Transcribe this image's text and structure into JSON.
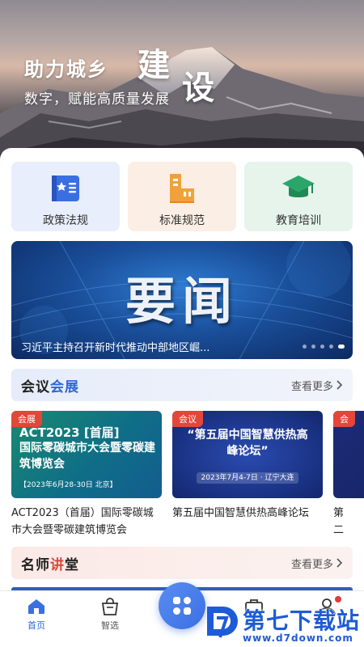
{
  "hero": {
    "title": "助力城乡",
    "big1": "建",
    "big2": "设",
    "subtitle": "数字，赋能高质量发展"
  },
  "categories": [
    {
      "label": "政策法规",
      "icon": "policy-book-icon",
      "color": "#3a6fe3"
    },
    {
      "label": "标准规范",
      "icon": "ruler-icon",
      "color": "#f0a23a"
    },
    {
      "label": "教育培训",
      "icon": "graduation-cap-icon",
      "color": "#2aa66a"
    }
  ],
  "banner": {
    "title": "要闻",
    "caption": "习近平主持召开新时代推动中部地区崛..."
  },
  "section_meetings": {
    "title_a": "会议",
    "title_b": "会展",
    "more": "查看更多"
  },
  "events": [
    {
      "tag": "会展",
      "thumb_line1": "ACT2023 [首届]",
      "thumb_line2": "国际零碳城市大会暨零碳建筑博览会",
      "thumb_line3": "【2023年6月28-30日 北京】",
      "caption": "ACT2023（首届）国际零碳城市大会暨零碳建筑博览会"
    },
    {
      "tag": "会议",
      "thumb_line1": "“第五届中国智慧供热高峰论坛”",
      "thumb_line3": "2023年7月4-7日 · 辽宁大连",
      "caption": "第五届中国智慧供热高峰论坛"
    },
    {
      "tag": "会",
      "caption": "第二筑发"
    }
  ],
  "section_teachers": {
    "title_a": "名师",
    "title_b": "讲",
    "title_c": "堂",
    "more": "查看更多"
  },
  "tabs": [
    {
      "label": "首页",
      "icon": "home-icon",
      "active": true
    },
    {
      "label": "智选",
      "icon": "shopping-bag-icon",
      "active": false
    },
    {
      "label": "",
      "icon": "apps-grid-icon",
      "active": false
    },
    {
      "label": "",
      "icon": "briefcase-icon",
      "active": false
    },
    {
      "label": "",
      "icon": "user-icon",
      "active": false
    }
  ],
  "watermark": {
    "brand": "第七下载站",
    "url": "www.d7down.com"
  },
  "colors": {
    "primary": "#3a6fe3",
    "accent_red": "#e2473a"
  }
}
